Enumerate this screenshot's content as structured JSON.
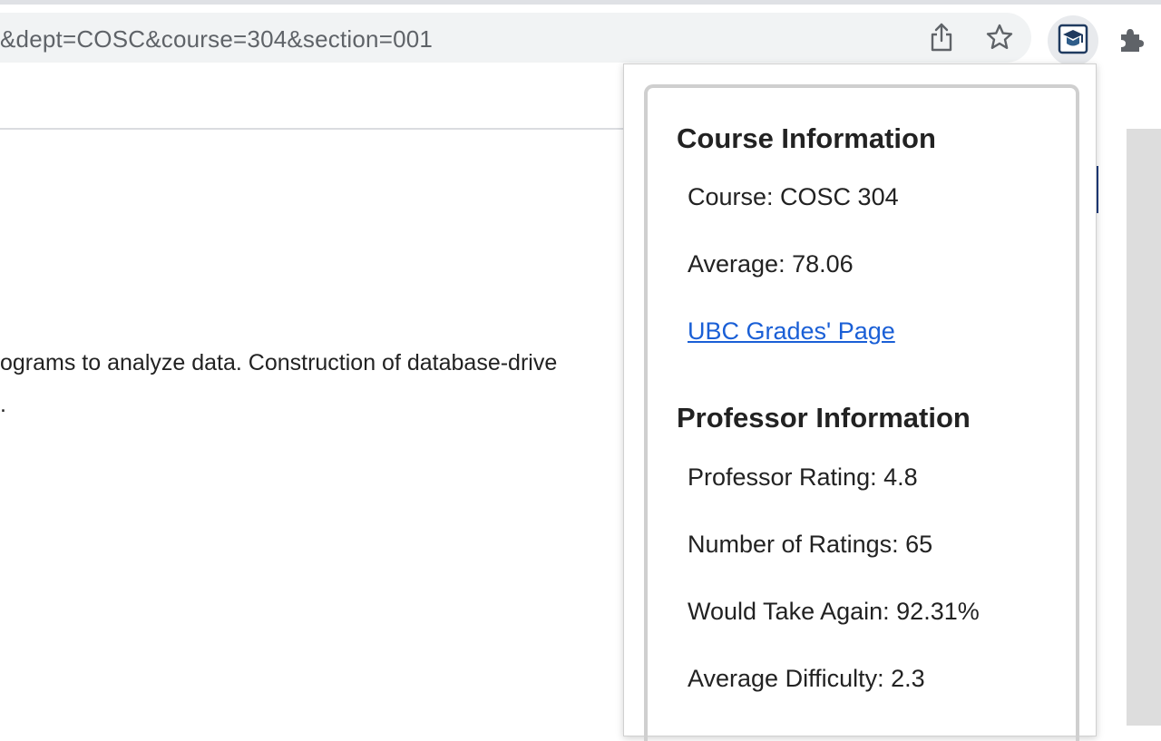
{
  "browser": {
    "url": "&dept=COSC&course=304&section=001",
    "icons": {
      "share": "share-icon",
      "bookmark": "star-icon",
      "extension": "graduation-cap-extension-icon",
      "extensions_menu": "puzzle-icon"
    }
  },
  "page": {
    "description_line": "ograms to analyze data. Construction of database-drive",
    "description_frag": "."
  },
  "popup": {
    "course_section": {
      "title": "Course Information",
      "course": "Course: COSC 304",
      "average": "Average: 78.06",
      "link_text": "UBC Grades' Page"
    },
    "professor_section": {
      "title": "Professor Information",
      "rating": "Professor Rating: 4.8",
      "num_ratings": "Number of Ratings: 65",
      "take_again": "Would Take Again: 92.31%",
      "difficulty": "Average Difficulty: 2.3"
    }
  },
  "colors": {
    "link": "#1a5fd6",
    "omnibox": "#f1f3f4",
    "extension_icon": "#1f3a5f"
  }
}
